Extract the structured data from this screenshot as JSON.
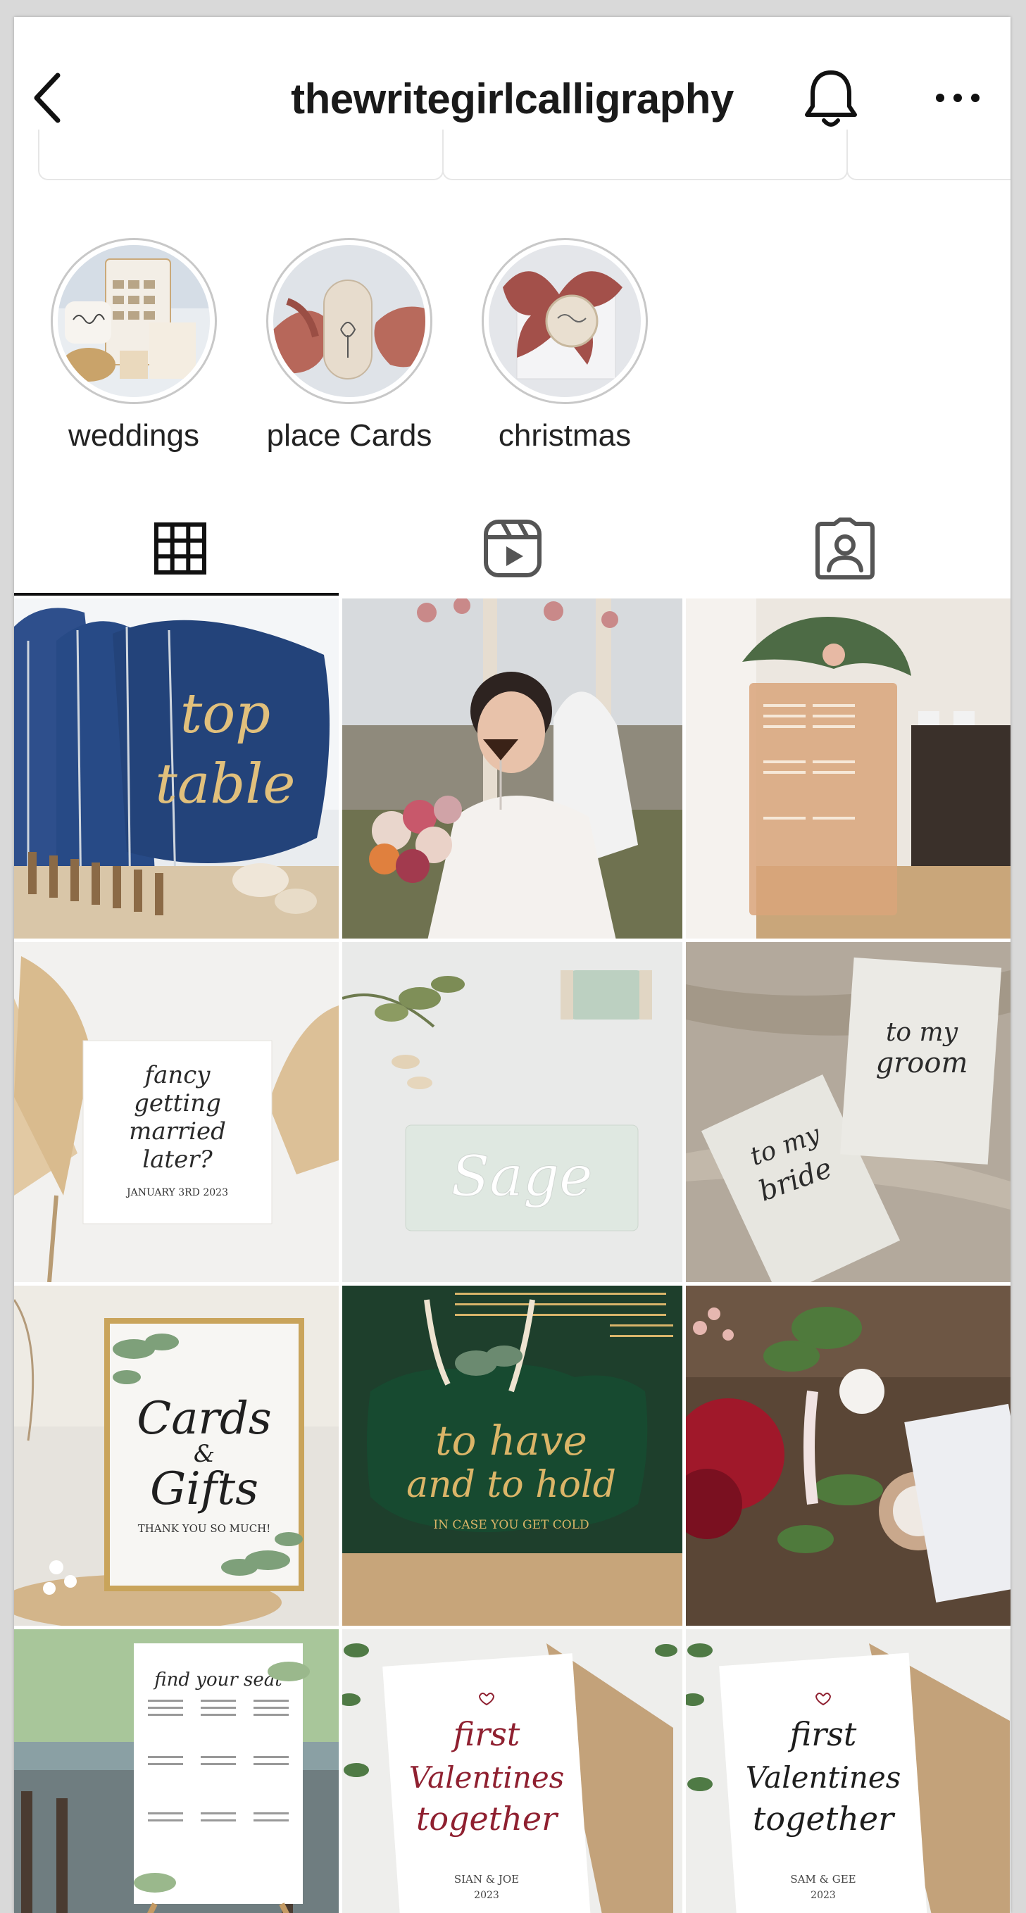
{
  "header": {
    "title": "thewritegirlcalligraphy",
    "back_icon": "chevron-left-icon",
    "bell_icon": "bell-icon",
    "more_icon": "more-horizontal-icon"
  },
  "highlights": [
    {
      "label": "weddings"
    },
    {
      "label": "place Cards"
    },
    {
      "label": "christmas"
    }
  ],
  "tabs": [
    {
      "icon": "grid-icon",
      "active": true
    },
    {
      "icon": "reels-icon",
      "active": false
    },
    {
      "icon": "tagged-icon",
      "active": false
    }
  ],
  "posts": [
    {
      "text": [
        "top",
        "table"
      ]
    },
    {
      "text": []
    },
    {
      "text": []
    },
    {
      "text": [
        "fancy",
        "getting",
        "married",
        "later?",
        "JANUARY 3RD 2023"
      ]
    },
    {
      "text": [
        "Sage"
      ]
    },
    {
      "text": [
        "to my",
        "bride",
        "to my",
        "groom"
      ]
    },
    {
      "text": [
        "Cards",
        "&",
        "Gifts",
        "THANK YOU SO MUCH!"
      ]
    },
    {
      "text": [
        "to have",
        "and to hold",
        "IN CASE YOU GET COLD"
      ]
    },
    {
      "text": []
    },
    {
      "text": [
        "find your seat"
      ]
    },
    {
      "text": [
        "first",
        "Valentines",
        "together",
        "SIAN & JOE",
        "2023"
      ]
    },
    {
      "text": [
        "first",
        "Valentines",
        "together",
        "SAM & GEE",
        "2023"
      ]
    }
  ],
  "colors": {
    "text": "#1a1a1a",
    "ring": "#c8c8c8",
    "navy": "#23437a",
    "gold": "#d9b46a",
    "green": "#1f4b35",
    "burgundy": "#8f2030",
    "kraft": "#c3a27a"
  }
}
